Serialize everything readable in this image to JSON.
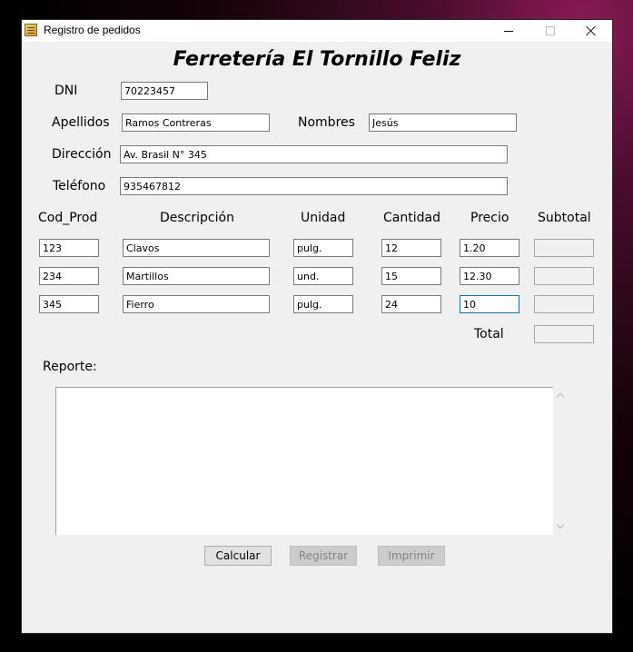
{
  "window": {
    "title": "Registro de pedidos"
  },
  "heading": "Ferretería El Tornillo Feliz",
  "customer": {
    "dni_label": "DNI",
    "dni_value": "70223457",
    "apellidos_label": "Apellidos",
    "apellidos_value": "Ramos Contreras",
    "nombres_label": "Nombres",
    "nombres_value": "Jesús",
    "direccion_label": "Dirección",
    "direccion_value": "Av. Brasil N° 345",
    "telefono_label": "Teléfono",
    "telefono_value": "935467812"
  },
  "table": {
    "headers": [
      "Cod_Prod",
      "Descripción",
      "Unidad",
      "Cantidad",
      "Precio",
      "Subtotal"
    ],
    "rows": [
      {
        "cod": "123",
        "desc": "Clavos",
        "unidad": "pulg.",
        "cantidad": "12",
        "precio": "1.20",
        "subtotal": ""
      },
      {
        "cod": "234",
        "desc": "Martillos",
        "unidad": "und.",
        "cantidad": "15",
        "precio": "12.30",
        "subtotal": ""
      },
      {
        "cod": "345",
        "desc": "Fierro",
        "unidad": "pulg.",
        "cantidad": "24",
        "precio": "10",
        "subtotal": ""
      }
    ],
    "total_label": "Total",
    "total_value": ""
  },
  "report": {
    "label": "Reporte:",
    "content": ""
  },
  "buttons": {
    "calcular": "Calcular",
    "registrar": "Registrar",
    "imprimir": "Imprimir"
  }
}
